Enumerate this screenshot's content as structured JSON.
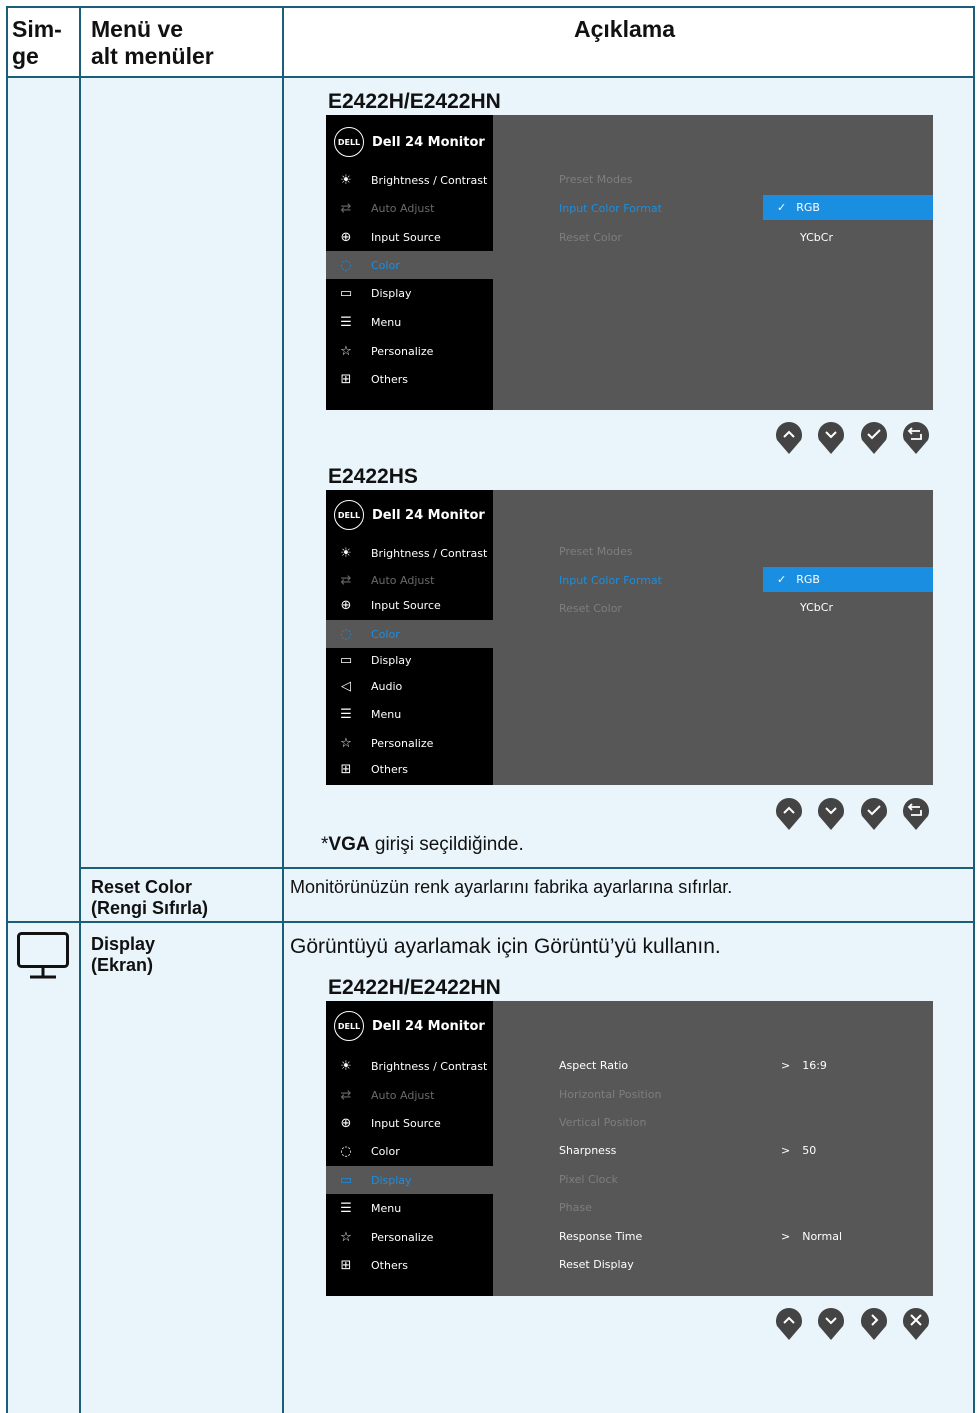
{
  "header": {
    "col1": "Sim-\nge",
    "col2": "Menü ve\nalt menüler",
    "col3": "Açıklama"
  },
  "osd_common": {
    "title": "Dell 24 Monitor",
    "logo": "DELL",
    "items": {
      "brightness": "Brightness / Contrast",
      "auto": "Auto Adjust",
      "input": "Input Source",
      "color": "Color",
      "display": "Display",
      "audio": "Audio",
      "menu": "Menu",
      "personalize": "Personalize",
      "others": "Others"
    }
  },
  "color_section": {
    "model1": "E2422H/E2422HN",
    "model2": "E2422HS",
    "options": {
      "preset": "Preset Modes",
      "icf": "Input Color Format",
      "reset": "Reset Color"
    },
    "values": {
      "rgb": "RGB",
      "ycbcr": "YCbCr"
    },
    "footnote_star": "*",
    "footnote_bold": "VGA",
    "footnote_rest": " girişi seçildiğinde."
  },
  "reset_row": {
    "name": "Reset Color\n(Rengi Sıfırla)",
    "desc": "Monitörünüzün renk ayarlarını fabrika ayarlarına sıfırlar."
  },
  "display_row": {
    "name": "Display\n(Ekran)",
    "desc": "Görüntüyü ayarlamak için Görüntü’yü kullanın.",
    "model": "E2422H/E2422HN",
    "options": {
      "aspect": "Aspect Ratio",
      "hpos": "Horizontal Position",
      "vpos": "Vertical Position",
      "sharp": "Sharpness",
      "pixclk": "Pixel Clock",
      "phase": "Phase",
      "resp": "Response Time",
      "reset": "Reset Display"
    },
    "values": {
      "aspect": "16:9",
      "sharp": "50",
      "resp": "Normal"
    },
    "arrow": ">"
  },
  "colors": {
    "accent": "#1a8ee0",
    "row_bg": "#e9f5fb",
    "border": "#1b5e7a",
    "osd_bg": "#575757"
  }
}
